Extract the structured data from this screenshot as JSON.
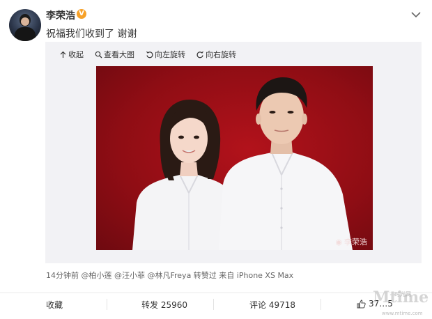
{
  "post": {
    "author": "李荣浩",
    "verified_badge": "V",
    "text": "祝福我们收到了 谢谢",
    "menu_icon": "chevron-down-icon"
  },
  "toolbar": {
    "collapse": "收起",
    "view_large": "查看大图",
    "rotate_left": "向左旋转",
    "rotate_right": "向右旋转"
  },
  "photo": {
    "watermark": "李荣浩"
  },
  "meta": {
    "text": "14分钟前 @柏小莲 @汪小菲 @林凡Freya 转赞过  来自 iPhone XS Max"
  },
  "actions": {
    "favorite": "收藏",
    "repost": "转发 25960",
    "comment": "评论 49718",
    "like": "37…5"
  },
  "site_watermark": {
    "logo": "Mtime",
    "sub": "时光网",
    "url": "www.mtime.com"
  },
  "colors": {
    "accent_orange": "#f7a128",
    "photo_red": "#a3101a",
    "panel_bg": "#f2f2f5"
  }
}
